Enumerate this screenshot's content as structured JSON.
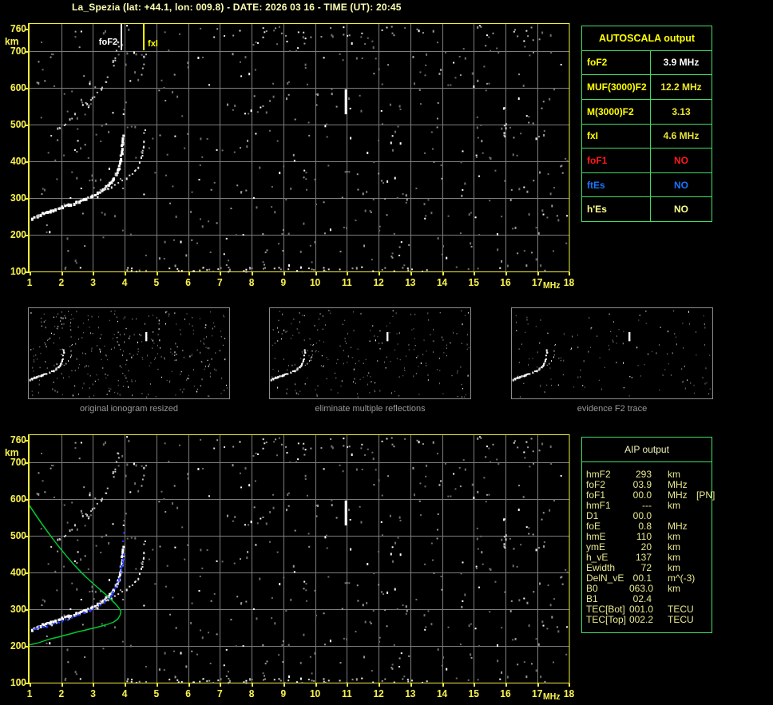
{
  "title": "La_Spezia (lat: +44.1, lon: 009.8) - DATE: 2026 03 16 - TIME (UT): 20:45",
  "colors": {
    "background": "#000000",
    "axis_yellow": "#f2ef3c",
    "axis_text_yellow": "#f7f14d",
    "title_yellow": "#ffffb3",
    "grid_gray": "#7d7d7d",
    "table_green": "#44dd66",
    "trace_white": "#ffffff",
    "profile_green": "#00c832",
    "fit_blue": "#2438ff",
    "value_red": "#ff1a1a",
    "value_blue": "#1a75ff",
    "pale_yellow": "#ffff8c",
    "caption_gray": "#9a9a9a"
  },
  "autoscala_table": {
    "header": "AUTOSCALA output",
    "rows": [
      {
        "label": "foF2",
        "value": "3.9 MHz",
        "label_color": "#ffff00",
        "value_color": "#ffffff"
      },
      {
        "label": "MUF(3000)F2",
        "value": "12.2 MHz",
        "label_color": "#ffff00",
        "value_color": "#f0e82a"
      },
      {
        "label": "M(3000)F2",
        "value": "3.13",
        "label_color": "#ffff00",
        "value_color": "#f0e82a"
      },
      {
        "label": "fxI",
        "value": "4.6 MHz",
        "label_color": "#ffff00",
        "value_color": "#e8e23a"
      },
      {
        "label": "foF1",
        "value": "NO",
        "label_color": "#ff1a1a",
        "value_color": "#ff1a1a"
      },
      {
        "label": "ftEs",
        "value": "NO",
        "label_color": "#1a75ff",
        "value_color": "#1a75ff"
      },
      {
        "label": "h'Es",
        "value": "NO",
        "label_color": "#ffff8c",
        "value_color": "#ffff8c"
      }
    ]
  },
  "thumbnails": [
    {
      "caption": "original ionogram resized"
    },
    {
      "caption": "eliminate multiple reflections"
    },
    {
      "caption": "evidence F2 trace"
    }
  ],
  "aip_table": {
    "header": "AIP output",
    "rows": [
      {
        "param": "hmF2",
        "value": "293",
        "unit": "km",
        "extra": ""
      },
      {
        "param": "foF2",
        "value": "03.9",
        "unit": "MHz",
        "extra": ""
      },
      {
        "param": "foF1",
        "value": "00.0",
        "unit": "MHz",
        "extra": "[PN]"
      },
      {
        "param": "hmF1",
        "value": "---",
        "unit": "km",
        "extra": ""
      },
      {
        "param": "D1",
        "value": "00.0",
        "unit": "",
        "extra": ""
      },
      {
        "param": "foE",
        "value": "0.8",
        "unit": "MHz",
        "extra": ""
      },
      {
        "param": "hmE",
        "value": "110",
        "unit": "km",
        "extra": ""
      },
      {
        "param": "ymE",
        "value": "20",
        "unit": "km",
        "extra": ""
      },
      {
        "param": "h_vE",
        "value": "137",
        "unit": "km",
        "extra": ""
      },
      {
        "param": "Ewidth",
        "value": "72",
        "unit": "km",
        "extra": ""
      },
      {
        "param": "DelN_vE",
        "value": "00.1",
        "unit": "m^(-3)",
        "extra": ""
      },
      {
        "param": "B0",
        "value": "063.0",
        "unit": "km",
        "extra": ""
      },
      {
        "param": "B1",
        "value": "02.4",
        "unit": "",
        "extra": ""
      },
      {
        "param": "TEC[Bot]",
        "value": "001.0",
        "unit": "TECU",
        "extra": ""
      },
      {
        "param": "TEC[Top]",
        "value": "002.2",
        "unit": "TECU",
        "extra": ""
      }
    ]
  },
  "ionogram_series": {
    "o_trace": {
      "name": "F2 O-mode echo trace",
      "color": "#ffffff",
      "mode": "dots",
      "size": 3,
      "density": 0.9,
      "jitter": 1,
      "points": [
        [
          1.05,
          248
        ],
        [
          1.2,
          254
        ],
        [
          1.4,
          260
        ],
        [
          1.6,
          266
        ],
        [
          1.8,
          272
        ],
        [
          2.0,
          278
        ],
        [
          2.2,
          284
        ],
        [
          2.45,
          291
        ],
        [
          2.7,
          299
        ],
        [
          2.9,
          307
        ],
        [
          3.1,
          316
        ],
        [
          3.3,
          327
        ],
        [
          3.45,
          338
        ],
        [
          3.6,
          352
        ],
        [
          3.7,
          367
        ],
        [
          3.78,
          384
        ],
        [
          3.83,
          403
        ],
        [
          3.87,
          425
        ],
        [
          3.9,
          450
        ],
        [
          3.93,
          478
        ]
      ]
    },
    "x_trace": {
      "name": "F2 X-mode echo trace",
      "color": "#e6e6e6",
      "mode": "dots",
      "size": 2,
      "density": 0.5,
      "jitter": 1,
      "points": [
        [
          3.35,
          325
        ],
        [
          3.55,
          333
        ],
        [
          3.75,
          342
        ],
        [
          3.95,
          352
        ],
        [
          4.15,
          363
        ],
        [
          4.3,
          376
        ],
        [
          4.42,
          392
        ],
        [
          4.5,
          412
        ],
        [
          4.56,
          438
        ],
        [
          4.6,
          468
        ],
        [
          4.62,
          500
        ],
        [
          4.63,
          525
        ]
      ]
    },
    "second_hop": {
      "name": "second-hop multiple reflection",
      "color": "#c3c3c3",
      "mode": "dots",
      "size": 2,
      "density": 0.45,
      "jitter": 2,
      "points": [
        [
          1.7,
          476
        ],
        [
          1.9,
          491
        ],
        [
          2.1,
          506
        ],
        [
          2.3,
          521
        ],
        [
          2.5,
          537
        ],
        [
          2.7,
          553
        ],
        [
          2.9,
          570
        ],
        [
          3.1,
          588
        ],
        [
          3.25,
          604
        ],
        [
          3.4,
          622
        ],
        [
          3.52,
          641
        ],
        [
          3.62,
          662
        ],
        [
          3.7,
          684
        ],
        [
          3.76,
          708
        ],
        [
          3.8,
          730
        ]
      ]
    },
    "second_hop_x": {
      "name": "second-hop X-mode fragments",
      "color": "#b2b2b2",
      "mode": "dots",
      "size": 2,
      "density": 0.4,
      "jitter": 2,
      "points": [
        [
          4.45,
          598
        ],
        [
          4.5,
          622
        ],
        [
          4.55,
          648
        ],
        [
          4.58,
          672
        ],
        [
          4.6,
          695
        ]
      ]
    },
    "rfi_11mhz": {
      "name": "interference line near 11 MHz",
      "color": "#ffffff",
      "mode": "segment",
      "width": 3,
      "points": [
        [
          10.97,
          528
        ],
        [
          10.97,
          596
        ]
      ]
    },
    "rfi_16mhz": {
      "name": "interference dots near 16 MHz",
      "color": "#d2d2d2",
      "mode": "dots",
      "size": 2,
      "density": 0.6,
      "jitter": 1,
      "points": [
        [
          15.95,
          462
        ],
        [
          15.97,
          505
        ]
      ]
    },
    "profile": {
      "name": "electron density profile (AIP)",
      "color": "#00c832",
      "mode": "line",
      "width": 1.5,
      "points": [
        [
          1.0,
          582
        ],
        [
          1.2,
          556
        ],
        [
          1.4,
          531
        ],
        [
          1.6,
          507
        ],
        [
          1.8,
          484
        ],
        [
          2.0,
          462
        ],
        [
          2.2,
          441
        ],
        [
          2.4,
          421
        ],
        [
          2.6,
          403
        ],
        [
          2.8,
          386
        ],
        [
          3.0,
          370
        ],
        [
          3.2,
          355
        ],
        [
          3.4,
          340
        ],
        [
          3.55,
          328
        ],
        [
          3.7,
          315
        ],
        [
          3.8,
          305
        ],
        [
          3.87,
          296
        ],
        [
          3.88,
          293
        ],
        [
          3.85,
          283
        ],
        [
          3.78,
          273
        ],
        [
          3.65,
          265
        ],
        [
          3.5,
          260
        ],
        [
          3.3,
          255
        ],
        [
          3.1,
          250
        ],
        [
          2.9,
          246
        ],
        [
          2.7,
          242
        ],
        [
          2.5,
          238
        ],
        [
          2.3,
          233
        ],
        [
          2.1,
          229
        ],
        [
          1.9,
          224
        ],
        [
          1.7,
          220
        ],
        [
          1.5,
          215
        ],
        [
          1.3,
          209
        ],
        [
          1.1,
          205
        ],
        [
          1.0,
          203
        ]
      ]
    },
    "fit_trace": {
      "name": "Autoscala fitted trace",
      "color": "#2438ff",
      "mode": "dots",
      "size": 2,
      "density": 0.95,
      "jitter": 1,
      "points": [
        [
          1.1,
          248
        ],
        [
          1.3,
          252
        ],
        [
          1.5,
          257
        ],
        [
          1.7,
          262
        ],
        [
          1.9,
          267
        ],
        [
          2.1,
          273
        ],
        [
          2.3,
          279
        ],
        [
          2.5,
          285
        ],
        [
          2.7,
          292
        ],
        [
          2.9,
          300
        ],
        [
          3.05,
          307
        ],
        [
          3.2,
          314
        ],
        [
          3.35,
          323
        ],
        [
          3.5,
          334
        ],
        [
          3.6,
          346
        ],
        [
          3.7,
          362
        ],
        [
          3.78,
          381
        ],
        [
          3.84,
          402
        ],
        [
          3.89,
          420
        ],
        [
          3.93,
          437
        ],
        [
          3.96,
          452
        ]
      ],
      "extra_dots": [
        [
          3.95,
          510
        ],
        [
          3.92,
          487
        ]
      ]
    }
  },
  "chart_data": [
    {
      "type": "scatter",
      "role": "top-ionogram",
      "title": "scaled ionogram",
      "xlabel": "MHz",
      "ylabel": "km",
      "xlim": [
        1,
        18
      ],
      "ylim": [
        100,
        775
      ],
      "grid": true,
      "xticks": [
        1,
        2,
        3,
        4,
        5,
        6,
        7,
        8,
        9,
        10,
        11,
        12,
        13,
        14,
        15,
        16,
        17,
        18
      ],
      "yticks": [
        100,
        200,
        300,
        400,
        500,
        600,
        700,
        760
      ],
      "series": [
        "o_trace",
        "x_trace",
        "second_hop",
        "second_hop_x",
        "rfi_11mhz",
        "rfi_16mhz"
      ],
      "markers": [
        {
          "label": "foF2",
          "freq": 3.9,
          "color": "#ffffff",
          "label_side": "left"
        },
        {
          "label": "fxI",
          "freq": 4.6,
          "color": "#ffff00",
          "label_side": "right"
        }
      ],
      "noise": {
        "seed": 1234,
        "count": 520,
        "bands": [
          {
            "count": 60,
            "f": [
              3.5,
              13.5
            ],
            "km": [
              101,
              113
            ]
          },
          {
            "count": 35,
            "f": [
              6,
              17.5
            ],
            "km": [
              738,
              772
            ]
          }
        ]
      }
    },
    {
      "type": "scatter",
      "role": "bottom-ionogram",
      "title": "ionogram with AIP profile",
      "xlabel": "MHz",
      "ylabel": "km",
      "xlim": [
        1,
        18
      ],
      "ylim": [
        100,
        775
      ],
      "grid": true,
      "xticks": [
        1,
        2,
        3,
        4,
        5,
        6,
        7,
        8,
        9,
        10,
        11,
        12,
        13,
        14,
        15,
        16,
        17,
        18
      ],
      "yticks": [
        100,
        200,
        300,
        400,
        500,
        600,
        700,
        760
      ],
      "series": [
        "o_trace",
        "x_trace",
        "second_hop",
        "second_hop_x",
        "rfi_11mhz",
        "rfi_16mhz",
        "profile",
        "fit_trace"
      ],
      "markers": [],
      "noise": {
        "seed": 1234,
        "count": 520,
        "bands": [
          {
            "count": 60,
            "f": [
              3.5,
              13.5
            ],
            "km": [
              101,
              113
            ]
          },
          {
            "count": 35,
            "f": [
              6,
              17.5
            ],
            "km": [
              738,
              772
            ]
          }
        ]
      }
    },
    {
      "type": "scatter",
      "role": "thumbnail-original",
      "title": "original ionogram resized",
      "xlim": [
        1,
        18
      ],
      "ylim": [
        100,
        775
      ],
      "grid": false,
      "series": [
        "o_trace",
        "x_trace",
        "second_hop",
        "second_hop_x",
        "rfi_11mhz"
      ],
      "noise": {
        "seed": 77,
        "count": 330,
        "bands": []
      }
    },
    {
      "type": "scatter",
      "role": "thumbnail-cleaned",
      "title": "eliminate multiple reflections",
      "xlim": [
        1,
        18
      ],
      "ylim": [
        100,
        775
      ],
      "grid": false,
      "series": [
        "o_trace",
        "x_trace",
        "rfi_11mhz"
      ],
      "noise": {
        "seed": 78,
        "count": 230,
        "bands": []
      }
    },
    {
      "type": "scatter",
      "role": "thumbnail-f2",
      "title": "evidence F2 trace",
      "xlim": [
        1,
        18
      ],
      "ylim": [
        100,
        775
      ],
      "grid": false,
      "series": [
        "o_trace",
        "x_trace",
        "rfi_11mhz"
      ],
      "noise": {
        "seed": 79,
        "count": 130,
        "bands": []
      }
    }
  ]
}
